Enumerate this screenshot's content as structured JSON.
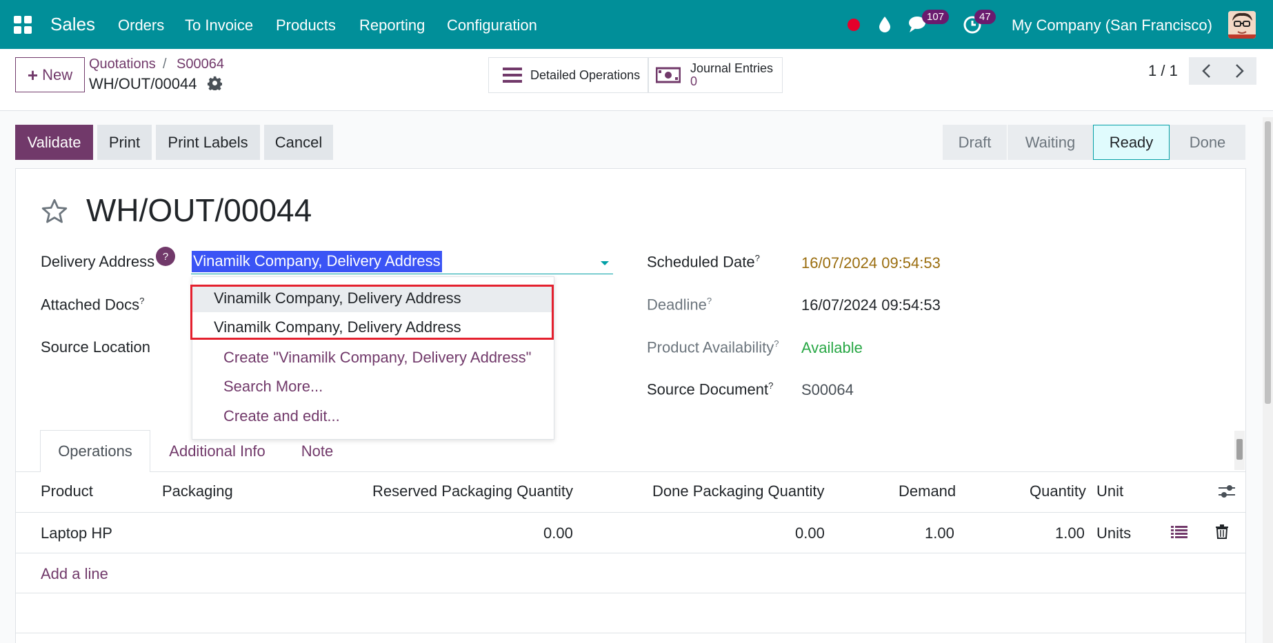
{
  "navbar": {
    "app_name": "Sales",
    "menu": [
      "Orders",
      "To Invoice",
      "Products",
      "Reporting",
      "Configuration"
    ],
    "messages_count": "107",
    "activities_count": "47",
    "company": "My Company (San Francisco)",
    "brand_color": "#018f99"
  },
  "control_panel": {
    "new_label": "New",
    "breadcrumb": [
      "Quotations",
      "S00064"
    ],
    "breadcrumb_sep": "/",
    "record_name": "WH/OUT/00044",
    "smart_buttons": {
      "detailed_operations": "Detailed Operations",
      "journal_entries_label": "Journal Entries",
      "journal_entries_count": "0"
    },
    "pager": "1 / 1"
  },
  "actions": {
    "validate": "Validate",
    "print": "Print",
    "print_labels": "Print Labels",
    "cancel": "Cancel"
  },
  "status_bar": {
    "stages": [
      "Draft",
      "Waiting",
      "Ready",
      "Done"
    ],
    "active": "Ready"
  },
  "form": {
    "title": "WH/OUT/00044",
    "labels": {
      "delivery_address": "Delivery Address",
      "attached_docs": "Attached Docs",
      "source_location": "Source Location",
      "scheduled_date": "Scheduled Date",
      "deadline": "Deadline",
      "product_availability": "Product Availability",
      "source_document": "Source Document"
    },
    "help_mark": "?",
    "tooltip_mark": "?",
    "delivery_address_value": "Vinamilk Company, Delivery Address",
    "scheduled_date_value": "16/07/2024 09:54:53",
    "deadline_value": "16/07/2024 09:54:53",
    "product_availability_value": "Available",
    "source_document_value": "S00064"
  },
  "dropdown": {
    "options": [
      "Vinamilk Company, Delivery Address",
      "Vinamilk Company, Delivery Address"
    ],
    "create": "Create \"Vinamilk Company, Delivery Address\"",
    "search_more": "Search More...",
    "create_edit": "Create and edit..."
  },
  "tabs": [
    "Operations",
    "Additional Info",
    "Note"
  ],
  "table": {
    "headers": {
      "product": "Product",
      "packaging": "Packaging",
      "reserved_qty": "Reserved Packaging Quantity",
      "done_qty": "Done Packaging Quantity",
      "demand": "Demand",
      "quantity": "Quantity",
      "unit": "Unit"
    },
    "rows": [
      {
        "product": "Laptop HP",
        "packaging": "",
        "reserved_qty": "0.00",
        "done_qty": "0.00",
        "demand": "1.00",
        "quantity": "1.00",
        "unit": "Units"
      }
    ],
    "add_line": "Add a line"
  }
}
